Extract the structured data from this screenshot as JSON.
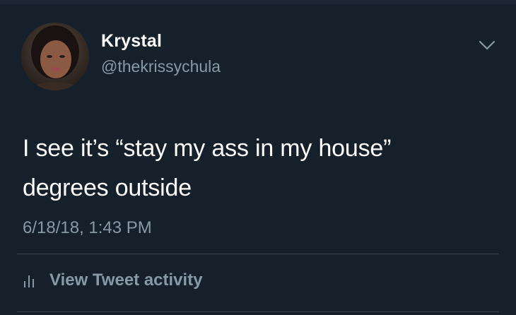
{
  "tweet": {
    "author": {
      "name": "Krystal",
      "handle": "@thekrissychula"
    },
    "text_line1": "I see it’s “stay my ass in my house”",
    "text_line2": "degrees outside",
    "timestamp": "6/18/18, 1:43 PM",
    "activity_label": "View Tweet activity"
  },
  "icons": {
    "menu": "chevron-down-icon",
    "activity": "bar-chart-icon"
  },
  "colors": {
    "background": "#15202b",
    "primary_text": "#ffffff",
    "secondary_text": "#8899a6",
    "divider": "#38444d"
  }
}
